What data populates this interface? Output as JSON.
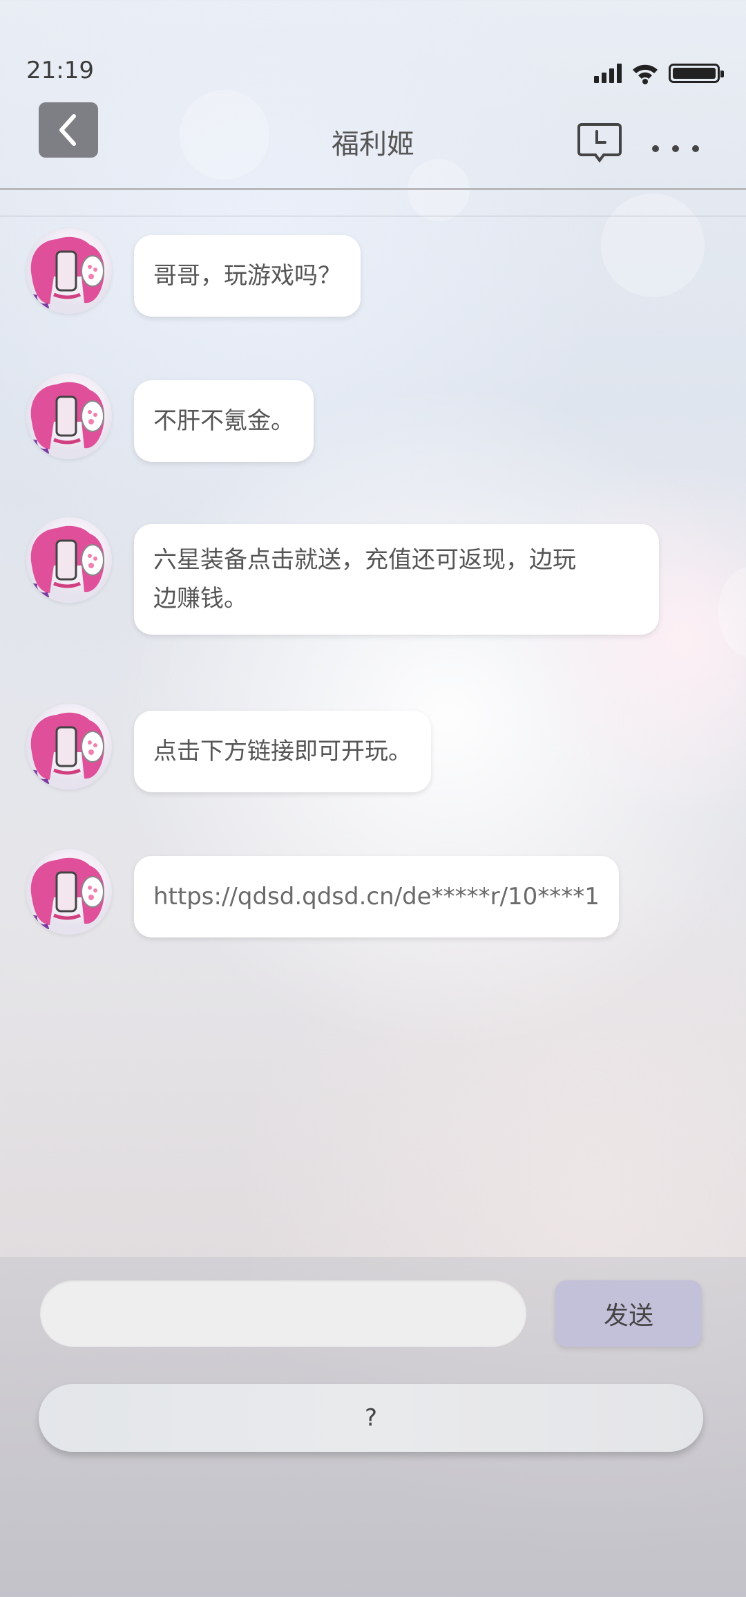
{
  "status_bar": {
    "time": "21:19"
  },
  "header": {
    "title": "福利姬",
    "back_icon": "chevron-left-icon",
    "history_icon": "chat-history-icon",
    "more_icon": "more-dots-icon"
  },
  "messages": [
    {
      "text": "哥哥，玩游戏吗？"
    },
    {
      "text": "不肝不氪金。"
    },
    {
      "text_line1": "六星装备点击就送，充值还可返现，边玩",
      "text_line2": "边赚钱。"
    },
    {
      "text": "点击下方链接即可开玩。"
    },
    {
      "text": "https://qdsd.qdsd.cn/de*****r/10****1"
    }
  ],
  "input": {
    "value": "",
    "placeholder": ""
  },
  "send_label": "发送",
  "question_label": "?",
  "colors": {
    "back_button": "#7e7f84",
    "send_button": "#c3c0d9",
    "bubble": "#ffffff"
  }
}
